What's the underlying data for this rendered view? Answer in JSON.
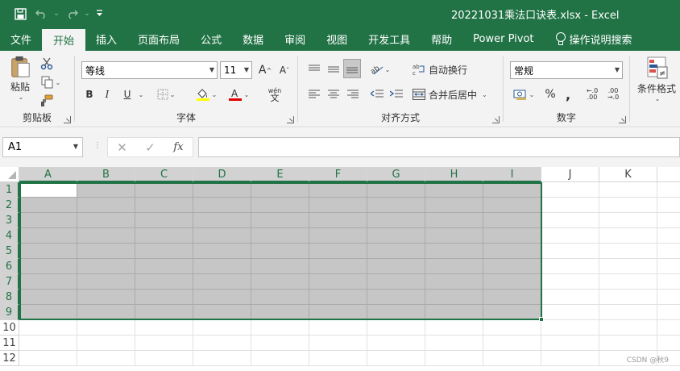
{
  "title_bar": {
    "title": "20221031乘法口诀表.xlsx  -  Excel",
    "qat": {
      "save_icon": "save-icon",
      "undo_icon": "undo-icon",
      "redo_icon": "redo-icon",
      "customize_icon": "customize-qat-icon"
    }
  },
  "tabs": [
    {
      "label": "文件",
      "active": false
    },
    {
      "label": "开始",
      "active": true
    },
    {
      "label": "插入",
      "active": false
    },
    {
      "label": "页面布局",
      "active": false
    },
    {
      "label": "公式",
      "active": false
    },
    {
      "label": "数据",
      "active": false
    },
    {
      "label": "审阅",
      "active": false
    },
    {
      "label": "视图",
      "active": false
    },
    {
      "label": "开发工具",
      "active": false
    },
    {
      "label": "帮助",
      "active": false
    },
    {
      "label": "Power Pivot",
      "active": false
    }
  ],
  "tell_me": "操作说明搜索",
  "ribbon": {
    "clipboard": {
      "group_label": "剪贴板",
      "paste_label": "粘贴"
    },
    "font": {
      "group_label": "字体",
      "font_name": "等线",
      "font_size": "11",
      "grow_label": "A",
      "shrink_label": "A",
      "bold": "B",
      "italic": "I",
      "underline": "U",
      "pinyin": "wén"
    },
    "alignment": {
      "group_label": "对齐方式",
      "wrap_label": "自动换行",
      "merge_label": "合并后居中"
    },
    "number": {
      "group_label": "数字",
      "format": "常规",
      "percent": "%",
      "comma": ",",
      "inc_decimal": ".00→.0",
      "dec_decimal": ".0→.00"
    },
    "styles": {
      "conditional_label": "条件格式"
    }
  },
  "formula_bar": {
    "name_box": "A1",
    "cancel": "✕",
    "enter": "✓",
    "fx": "fx",
    "formula": ""
  },
  "grid": {
    "columns": [
      "A",
      "B",
      "C",
      "D",
      "E",
      "F",
      "G",
      "H",
      "I",
      "J",
      "K"
    ],
    "rows": [
      "1",
      "2",
      "3",
      "4",
      "5",
      "6",
      "7",
      "8",
      "9",
      "10",
      "11",
      "12"
    ],
    "selection": "A1:I9",
    "active_cell": "A1"
  },
  "watermark": "CSDN @秋9",
  "colors": {
    "excel_green": "#217346",
    "selection_fill": "#c6c6c6",
    "ribbon_bg": "#f3f3f3"
  }
}
